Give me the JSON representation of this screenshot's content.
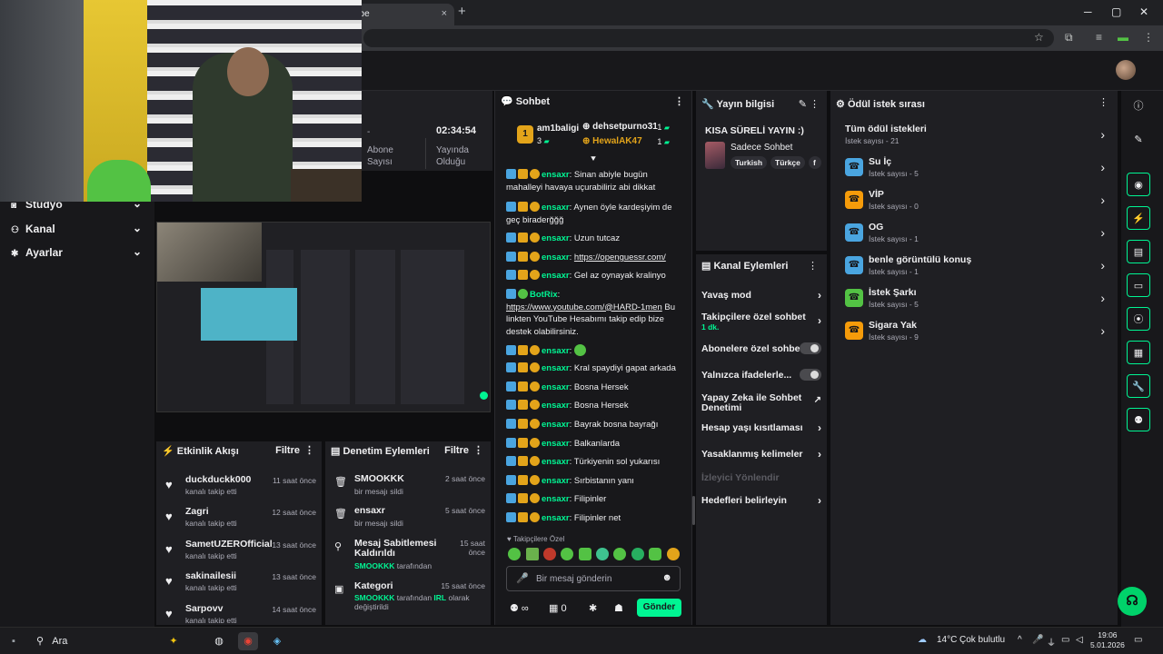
{
  "browser": {
    "tab_title": "ube",
    "tab_close": "×",
    "new_tab": "+",
    "win_min": "─",
    "win_max": "▢",
    "win_close": "✕"
  },
  "nav": {
    "items": [
      {
        "label": "Stüdyo",
        "icon": "studio-icon"
      },
      {
        "label": "Kanal",
        "icon": "channel-icon"
      },
      {
        "label": "Ayarlar",
        "icon": "gear-icon"
      }
    ]
  },
  "stats": {
    "dash": "-",
    "sub_label_1": "Abone",
    "sub_label_2": "Sayısı",
    "uptime": "02:34:54",
    "uptime_label_1": "Yayında",
    "uptime_label_2": "Olduğu"
  },
  "activity": {
    "title": "Etkinlik Akışı",
    "filter": "Filtre",
    "rows": [
      {
        "name": "duckduckk000",
        "sub": "kanalı takip etti",
        "time": "11 saat önce"
      },
      {
        "name": "Zagri",
        "sub": "kanalı takip etti",
        "time": "12 saat önce"
      },
      {
        "name": "SametUZEROfficial",
        "sub": "kanalı takip etti",
        "time": "13 saat önce"
      },
      {
        "name": "sakinailesii",
        "sub": "kanalı takip etti",
        "time": "13 saat önce"
      },
      {
        "name": "Sarpovv",
        "sub": "kanalı takip etti",
        "time": "14 saat önce"
      }
    ]
  },
  "moderation": {
    "title": "Denetim Eylemleri",
    "filter": "Filtre",
    "rows": [
      {
        "name": "SMOOKKK",
        "sub": "bir mesajı sildi",
        "time": "2 saat önce"
      },
      {
        "name": "ensaxr",
        "sub": "bir mesajı sildi",
        "time": "5 saat önce"
      },
      {
        "name": "Mesaj Sabitlemesi Kaldırıldı",
        "actor": "SMOOKKK",
        "sub": "tarafından",
        "time_1": "15 saat",
        "time_2": "önce"
      },
      {
        "name": "Kategori",
        "actor": "SMOOKKK",
        "sub_1": "tarafından",
        "value": "IRL",
        "sub_2": "olarak",
        "sub_3": "değiştirildi",
        "time": "15 saat önce"
      }
    ]
  },
  "chat": {
    "title": "Sohbet",
    "leaderboard": {
      "rank": "1",
      "top_name": "am1baligi",
      "top_count": "3",
      "others": [
        {
          "name": "dehsetpurno31",
          "count": "1"
        },
        {
          "name": "HewalAK47",
          "count": "1"
        }
      ]
    },
    "user": "ensaxr",
    "bot": "BotRix",
    "messages": [
      "Sinan abiyle bugün mahalleyi havaya uçurabiliriz abi dikkat",
      "Aynen öyle kardeşiyim de geç biraderğğğ",
      "Uzun tutcaz",
      "https://openguessr.com/",
      "Gel az oynayak kralinyo",
      "Kral spaydiyi gapat arkada",
      "Bosna Hersek",
      "Bosna Hersek",
      "Bayrak bosna bayrağı",
      "Balkanlarda",
      "Türkiyenin sol yukarısı",
      "Sırbistanın yanı",
      "Filipinler",
      "Filipinler net"
    ],
    "bot_link": "https://www.youtube.com/@HARD-1men",
    "bot_text": "Bu linkten YouTube Hesabımı takip edip bize destek olabilirsiniz.",
    "emote_label": "Takipçilere Özel",
    "input_placeholder": "Bir mesaj gönderin",
    "points": "0",
    "send": "Gönder",
    "infinity": "∞"
  },
  "stream_info": {
    "title": "Yayın bilgisi",
    "stream_title": "KISA SÜRELİ YAYIN :)",
    "category": "Sadece Sohbet",
    "tags": [
      "Turkish",
      "Türkçe",
      "f"
    ]
  },
  "channel_actions": {
    "title": "Kanal Eylemleri",
    "slow": "Yavaş mod",
    "followers_1": "Takipçilere özel sohbet",
    "followers_2": "1 dk.",
    "subs": "Abonelere özel sohbet",
    "emotes": "Yalnızca ifadelerle...",
    "ai_1": "Yapay Zeka ile Sohbet",
    "ai_2": "Denetimi",
    "age": "Hesap yaşı kısıtlaması",
    "banned": "Yasaklanmış kelimeler",
    "redirect": "İzleyici Yönlendir",
    "goals": "Hedefleri belirleyin"
  },
  "rewards": {
    "title": "Ödül istek sırası",
    "all": {
      "name": "Tüm ödül istekleri",
      "sub": "İstek sayısı - 21"
    },
    "items": [
      {
        "name": "Su İç",
        "sub": "İstek sayısı - 5",
        "color": "#4aa5e0"
      },
      {
        "name": "VİP",
        "sub": "İstek sayısı - 0",
        "color": "#f59b0a"
      },
      {
        "name": "OG",
        "sub": "İstek sayısı - 1",
        "color": "#4aa5e0"
      },
      {
        "name": "benle görüntülü konuş",
        "sub": "İstek sayısı - 1",
        "color": "#4aa5e0"
      },
      {
        "name": "İstek Şarkı",
        "sub": "İstek sayısı - 5",
        "color": "#53c244"
      },
      {
        "name": "Sigara Yak",
        "sub": "İstek sayısı - 9",
        "color": "#f59b0a"
      }
    ]
  },
  "taskbar": {
    "search": "Ara",
    "temp": "14°C",
    "weather": "Çok bulutlu",
    "time": "19:06",
    "date": "5.01.2026"
  }
}
